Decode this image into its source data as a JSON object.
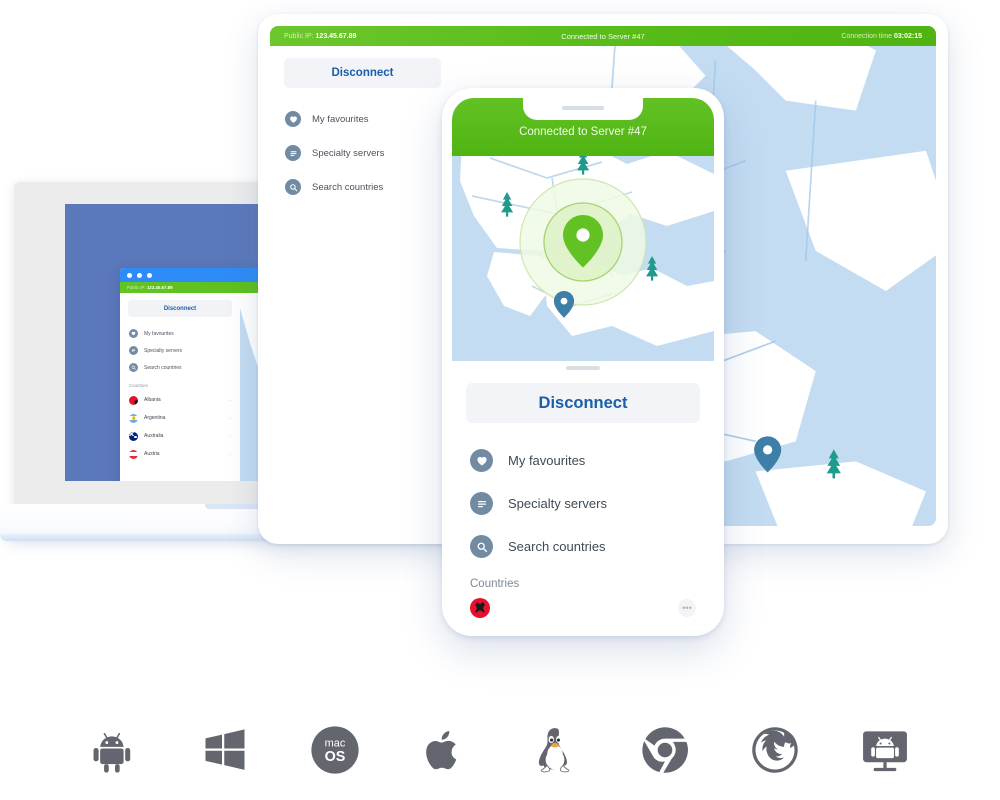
{
  "app": {
    "brand_green": "#57bb18",
    "brand_blue": "#1b5fa8",
    "icon_grey": "#718ba2",
    "map_water": "#c3dcf2",
    "map_land": "#ffffff",
    "pin_green": "#6bc02b",
    "pin_blue": "#3d7fa6",
    "tree_teal": "#1f9b8e"
  },
  "status_bar": {
    "public_ip_label": "Public IP:",
    "public_ip_value": "123.45.67.89",
    "connection_status": "Connected to Server #47",
    "connection_time_label": "Connection time",
    "connection_time_value": "03:02:15"
  },
  "sidebar": {
    "disconnect_label": "Disconnect",
    "items": [
      {
        "label": "My favourites",
        "icon": "heart-icon"
      },
      {
        "label": "Specialty servers",
        "icon": "list-icon"
      },
      {
        "label": "Search countries",
        "icon": "search-icon"
      }
    ],
    "countries_heading": "Countries",
    "countries": [
      {
        "name": "Albania",
        "flag": "f-albania",
        "arrow": "→"
      },
      {
        "name": "Argentina",
        "flag": "f-argentina",
        "arrow": "→"
      },
      {
        "name": "Australia",
        "flag": "f-australia",
        "arrow": "→"
      },
      {
        "name": "Austria",
        "flag": "f-austria",
        "arrow": "→"
      }
    ],
    "more_glyph": "•••"
  },
  "phone": {
    "title": "Connected to Server #47",
    "disconnect_label": "Disconnect"
  },
  "platforms": [
    {
      "name": "android-icon",
      "label": "Android"
    },
    {
      "name": "windows-icon",
      "label": "Windows"
    },
    {
      "name": "macos-icon",
      "label": "macOS",
      "text_top": "mac",
      "text_bottom": "OS"
    },
    {
      "name": "apple-icon",
      "label": "Apple iOS"
    },
    {
      "name": "linux-icon",
      "label": "Linux"
    },
    {
      "name": "chrome-icon",
      "label": "Chrome"
    },
    {
      "name": "firefox-icon",
      "label": "Firefox"
    },
    {
      "name": "android-tv-icon",
      "label": "Android TV"
    }
  ]
}
